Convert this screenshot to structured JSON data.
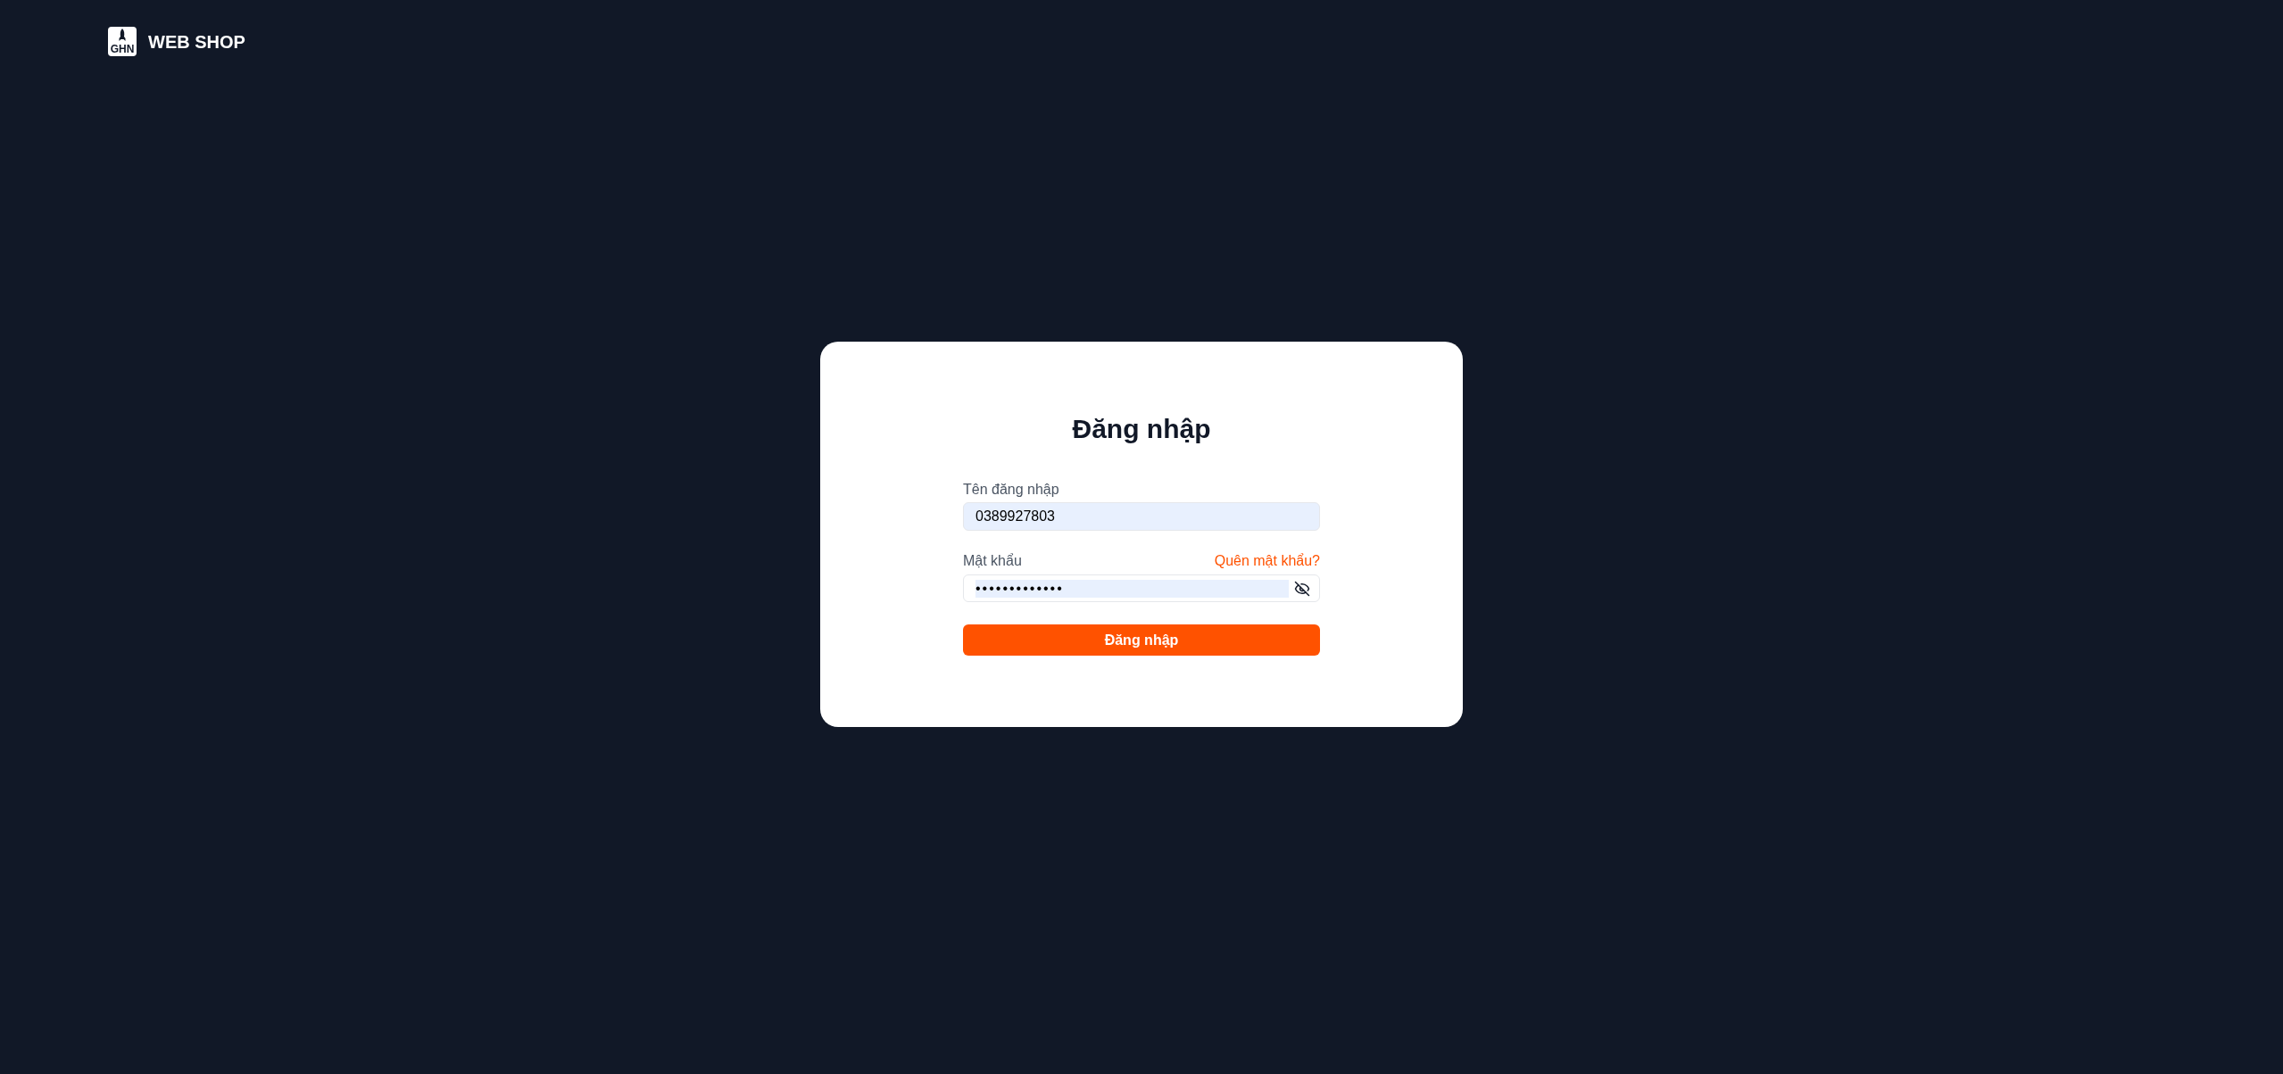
{
  "header": {
    "logo": {
      "badge": "GHN",
      "name": "WEB SHOP"
    }
  },
  "login_card": {
    "title": "Đăng nhập",
    "fields": [
      {
        "kind": "text",
        "label": "Tên đăng nhập",
        "value": "0389927803",
        "autofilled": true
      },
      {
        "kind": "password",
        "label": "Mật khẩu",
        "link": "Quên mật khẩu?",
        "value": "•••••••••••••",
        "autofilled": true
      }
    ],
    "submit": "Đăng nhập"
  }
}
